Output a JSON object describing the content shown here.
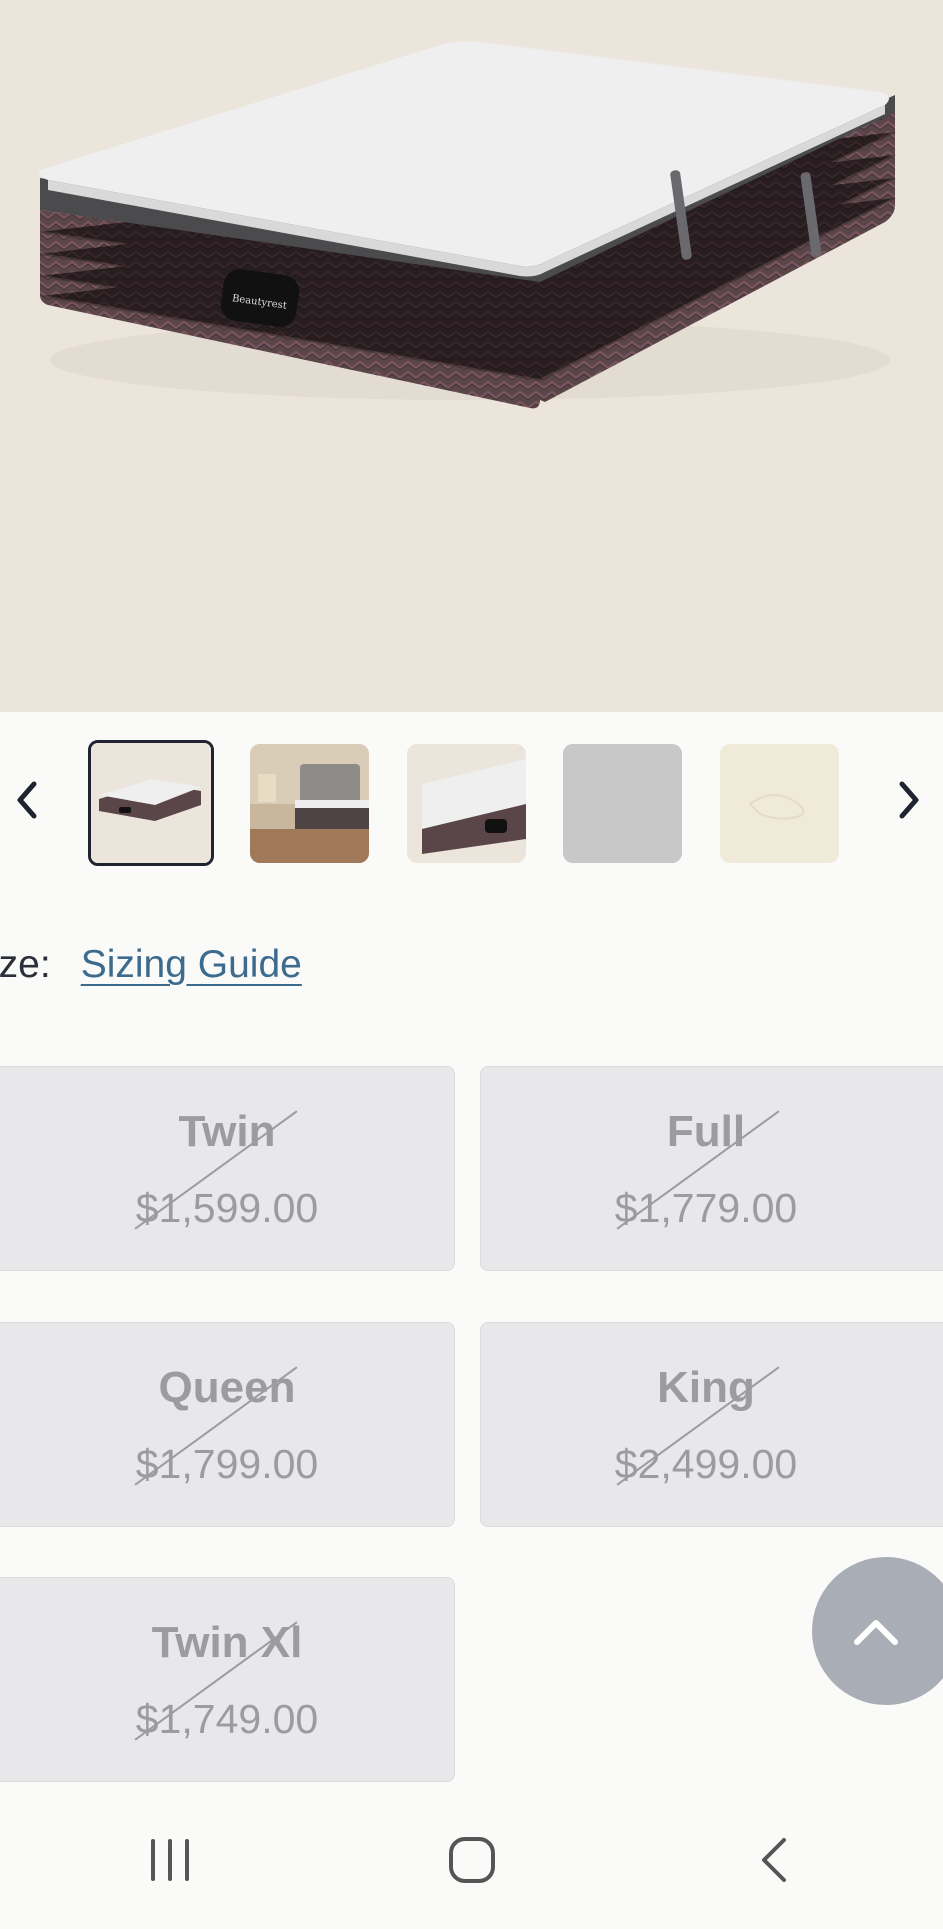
{
  "gallery": {
    "main_image_icon": "mattress-image",
    "thumbnails": [
      {
        "icon": "mattress-thumbnail",
        "selected": true
      },
      {
        "icon": "bedroom-scene-thumbnail",
        "selected": false
      },
      {
        "icon": "mattress-closeup-thumbnail",
        "selected": false
      },
      {
        "icon": "gray-placeholder-thumbnail",
        "selected": false
      },
      {
        "icon": "cream-texture-thumbnail",
        "selected": false
      }
    ],
    "prev_icon": "chevron-left-icon",
    "next_icon": "chevron-right-icon"
  },
  "size_selector": {
    "label": "ize:",
    "guide_link": "Sizing Guide",
    "options": [
      {
        "name": "Twin",
        "price": "$1,599.00",
        "available": false
      },
      {
        "name": "Full",
        "price": "$1,779.00",
        "available": false
      },
      {
        "name": "Queen",
        "price": "$1,799.00",
        "available": false
      },
      {
        "name": "King",
        "price": "$2,499.00",
        "available": false
      },
      {
        "name": "Twin Xl",
        "price": "$1,749.00",
        "available": false
      }
    ]
  },
  "back_to_top_icon": "chevron-up-icon",
  "system_nav": {
    "recents_icon": "recents-icon",
    "home_icon": "home-icon",
    "back_icon": "back-icon"
  },
  "colors": {
    "hero_bg": "#ece5dc",
    "card_bg": "#e8e8ea",
    "disabled_text": "#9b9ba0",
    "link": "#3d6b8e",
    "selected_border": "#1f2430"
  }
}
